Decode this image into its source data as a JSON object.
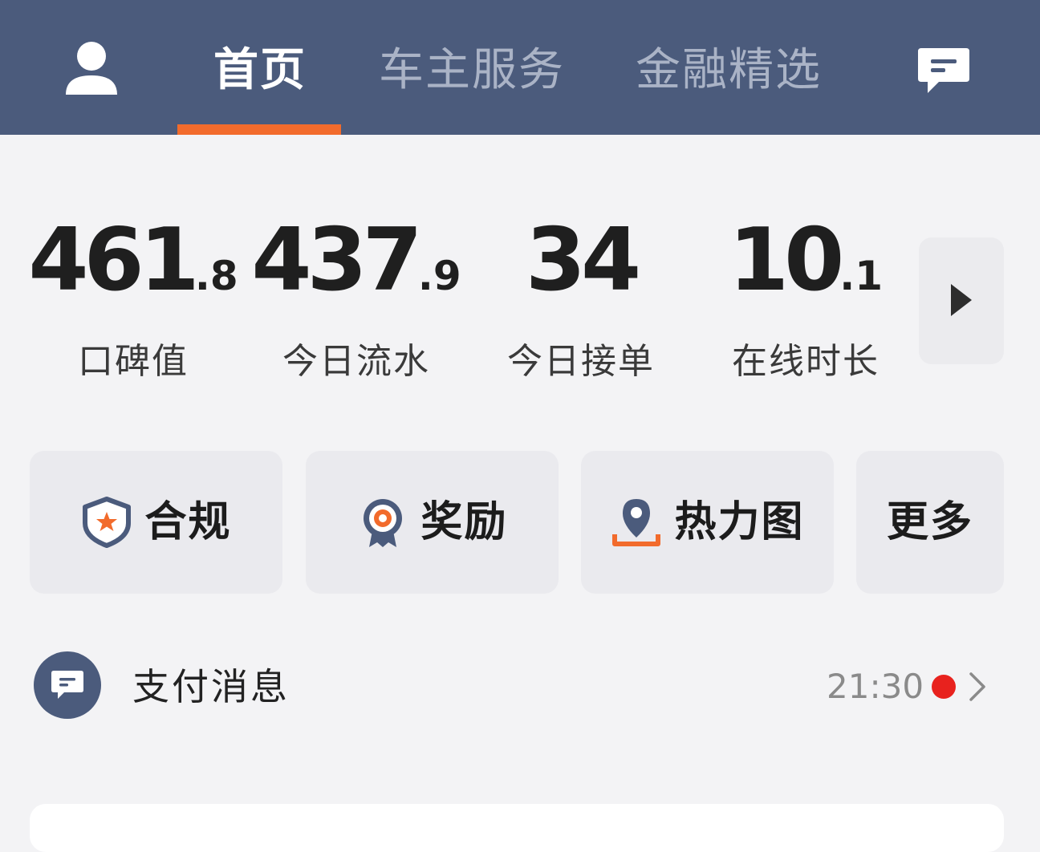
{
  "header": {
    "tabs": [
      {
        "label": "首页",
        "active": true
      },
      {
        "label": "车主服务",
        "active": false
      },
      {
        "label": "金融精选",
        "active": false
      }
    ],
    "avatar_icon": "user-icon",
    "message_icon": "chat-bubble-icon"
  },
  "stats": [
    {
      "int": "461",
      "dec": ".8",
      "label": "口碑值"
    },
    {
      "int": "437",
      "dec": ".9",
      "label": "今日流水"
    },
    {
      "int": "34",
      "dec": "",
      "label": "今日接单"
    },
    {
      "int": "10",
      "dec": ".1",
      "label": "在线时长"
    }
  ],
  "stats_more_icon": "play-triangle-icon",
  "actions": [
    {
      "label": "合规",
      "icon": "shield-star-icon"
    },
    {
      "label": "奖励",
      "icon": "medal-icon"
    },
    {
      "label": "热力图",
      "icon": "map-pin-icon"
    },
    {
      "label": "更多",
      "icon": ""
    }
  ],
  "payment_message": {
    "title": "支付消息",
    "time": "21:30",
    "unread": true,
    "icon": "message-icon"
  },
  "colors": {
    "header_bg": "#4b5b7c",
    "accent": "#f26b2c",
    "unread_dot": "#e8221e",
    "page_bg": "#f3f3f5"
  }
}
